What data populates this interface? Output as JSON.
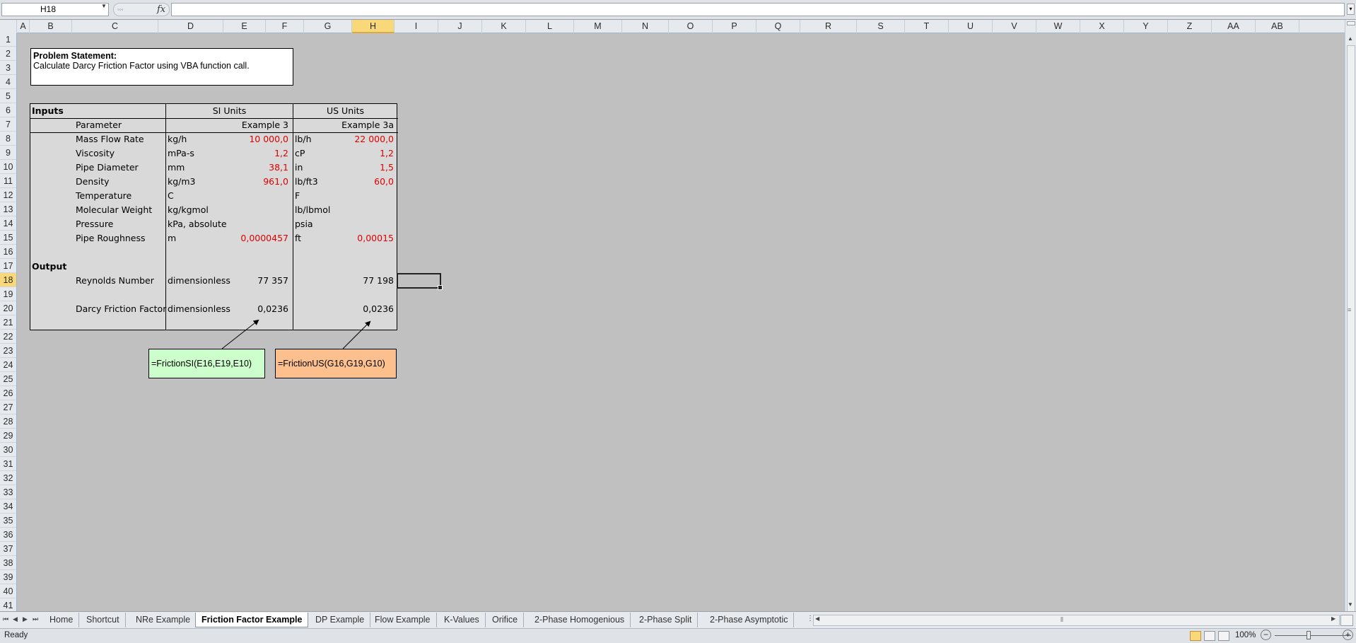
{
  "formula_bar": {
    "name_box": "H18",
    "fx_symbol": "fx",
    "formula": ""
  },
  "columns": [
    "A",
    "B",
    "C",
    "D",
    "E",
    "F",
    "G",
    "H",
    "I",
    "J",
    "K",
    "L",
    "M",
    "N",
    "O",
    "P",
    "Q",
    "R",
    "S",
    "T",
    "U",
    "V",
    "W",
    "X",
    "Y",
    "Z",
    "AA",
    "AB"
  ],
  "selected_column": "H",
  "rows": [
    "1",
    "2",
    "3",
    "4",
    "5",
    "6",
    "7",
    "8",
    "9",
    "10",
    "11",
    "12",
    "13",
    "14",
    "15",
    "16",
    "17",
    "18",
    "19",
    "20",
    "21",
    "22",
    "23",
    "24",
    "25",
    "26",
    "27",
    "28",
    "29",
    "30",
    "31",
    "32",
    "33",
    "34",
    "35",
    "36",
    "37",
    "38",
    "39",
    "40",
    "41"
  ],
  "selected_row": "18",
  "problem": {
    "title": "Problem Statement:",
    "text": "Calculate Darcy Friction Factor using VBA function call."
  },
  "table": {
    "inputs_label": "Inputs",
    "si_header": "SI Units",
    "us_header": "US Units",
    "parameter_header": "Parameter",
    "si_example": "Example 3",
    "us_example": "Example 3a",
    "rows": [
      {
        "param": "Mass Flow Rate",
        "si_unit": "kg/h",
        "si_value": "10 000,0",
        "us_unit": "lb/h",
        "us_value": "22 000,0"
      },
      {
        "param": "Viscosity",
        "si_unit": "mPa-s",
        "si_value": "1,2",
        "us_unit": "cP",
        "us_value": "1,2"
      },
      {
        "param": "Pipe Diameter",
        "si_unit": "mm",
        "si_value": "38,1",
        "us_unit": "in",
        "us_value": "1,5"
      },
      {
        "param": "Density",
        "si_unit": "kg/m3",
        "si_value": "961,0",
        "us_unit": "lb/ft3",
        "us_value": "60,0"
      },
      {
        "param": "Temperature",
        "si_unit": "C",
        "si_value": "",
        "us_unit": "F",
        "us_value": ""
      },
      {
        "param": "Molecular Weight",
        "si_unit": "kg/kgmol",
        "si_value": "",
        "us_unit": "lb/lbmol",
        "us_value": ""
      },
      {
        "param": "Pressure",
        "si_unit": "kPa, absolute",
        "si_value": "",
        "us_unit": "psia",
        "us_value": ""
      },
      {
        "param": "Pipe Roughness",
        "si_unit": "m",
        "si_value": "0,0000457",
        "us_unit": "ft",
        "us_value": "0,00015"
      }
    ],
    "output_label": "Output",
    "reynolds": {
      "param": "Reynolds Number",
      "unit": "dimensionless",
      "si_value": "77 357",
      "us_value": "77 198"
    },
    "friction": {
      "param": "Darcy Friction Factor",
      "unit": "dimensionless",
      "si_value": "0,0236",
      "us_value": "0,0236"
    }
  },
  "callouts": {
    "si_formula": "=FrictionSI(E16,E19,E10)",
    "us_formula": "=FrictionUS(G16,G19,G10)"
  },
  "sheet_tabs": [
    {
      "label": "Home",
      "active": false
    },
    {
      "label": "Shortcut",
      "active": false
    },
    {
      "label": "NRe Example",
      "active": false
    },
    {
      "label": "Friction Factor Example",
      "active": true
    },
    {
      "label": "DP Example",
      "active": false
    },
    {
      "label": "Flow Example",
      "active": false
    },
    {
      "label": "K-Values",
      "active": false
    },
    {
      "label": "Orifice",
      "active": false
    },
    {
      "label": "2-Phase Homogenious",
      "active": false
    },
    {
      "label": "2-Phase Split",
      "active": false
    },
    {
      "label": "2-Phase Asymptotic",
      "active": false
    }
  ],
  "status": {
    "ready": "Ready",
    "zoom": "100%",
    "zoom_level_percent": 100
  },
  "colors": {
    "red_value": "#e00000",
    "si_callout": "#ccffcc",
    "us_callout": "#fcc08f",
    "selection": "#f8d879",
    "background": "#c0c0c0"
  }
}
